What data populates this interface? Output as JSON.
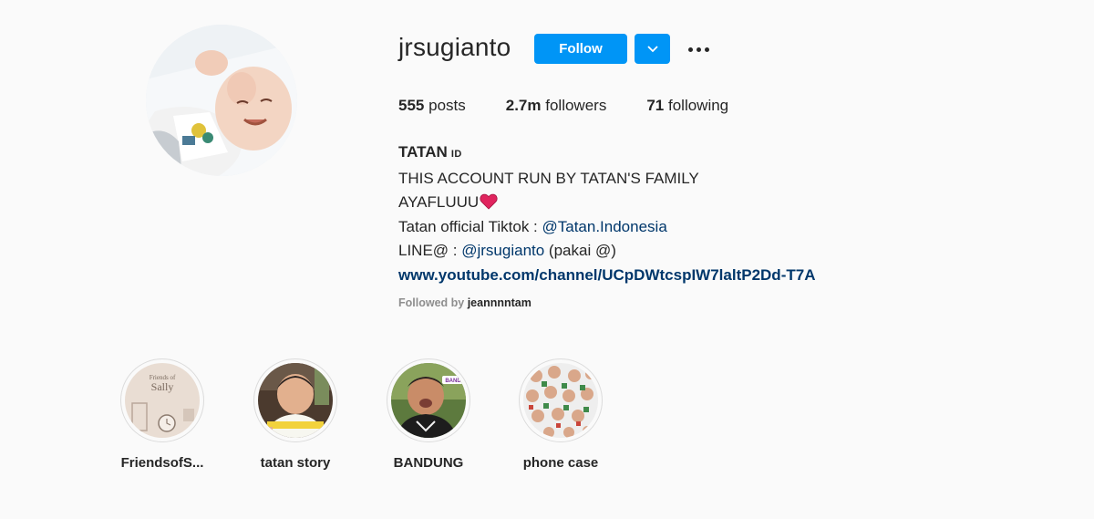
{
  "profile": {
    "username": "jrsugianto",
    "follow_label": "Follow",
    "avatar_icon": "profile-photo",
    "dropdown_icon": "chevron-down-icon",
    "more_icon": "more-options-icon"
  },
  "stats": {
    "posts_count": "555",
    "posts_label": "posts",
    "followers_count": "2.7m",
    "followers_label": "followers",
    "following_count": "71",
    "following_label": "following"
  },
  "bio": {
    "name": "TATAN",
    "name_tag": "ID",
    "line1": "THIS ACCOUNT RUN BY TATAN'S FAMILY",
    "line2": "AYAFLUUU",
    "line3_prefix": "Tatan official Tiktok : ",
    "line3_mention": "@Tatan.Indonesia",
    "line4_prefix": "LINE@ : ",
    "line4_mention": "@jrsugianto",
    "line4_suffix": " (pakai @)",
    "website": "www.youtube.com/channel/UCpDWtcspIW7laltP2Dd-T7A"
  },
  "followed_by": {
    "prefix": "Followed by ",
    "user": "jeannnntam"
  },
  "highlights": [
    {
      "label": "FriendsofS...",
      "image_text": "Friends of Sally"
    },
    {
      "label": "tatan story"
    },
    {
      "label": "BANDUNG",
      "image_text": "BAND"
    },
    {
      "label": "phone case"
    }
  ],
  "colors": {
    "accent": "#0095f6",
    "link": "#00376b",
    "background": "#fafafa",
    "secondary_text": "#8e8e8e",
    "heart": "#e0245e"
  }
}
